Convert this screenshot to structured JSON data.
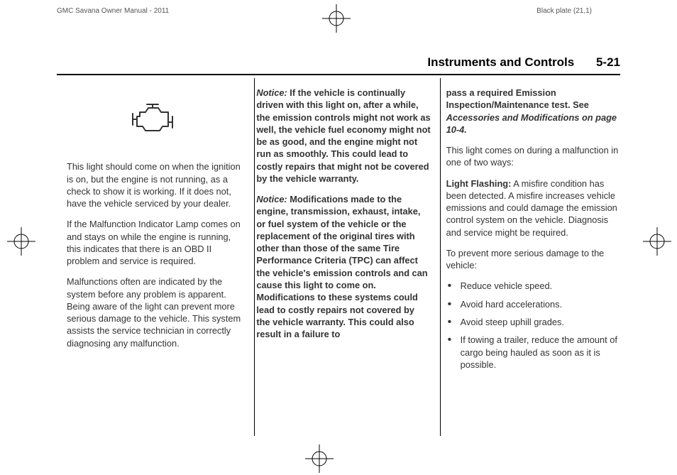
{
  "header_left": "GMC Savana Owner Manual - 2011",
  "header_right": "Black plate (21,1)",
  "page_title": "Instruments and Controls",
  "page_number": "5-21",
  "col1": {
    "p1": "This light should come on when the ignition is on, but the engine is not running, as a check to show it is working. If it does not, have the vehicle serviced by your dealer.",
    "p2": "If the Malfunction Indicator Lamp comes on and stays on while the engine is running, this indicates that there is an OBD II problem and service is required.",
    "p3": "Malfunctions often are indicated by the system before any problem is apparent. Being aware of the light can prevent more serious damage to the vehicle. This system assists the service technician in correctly diagnosing any malfunction."
  },
  "col2": {
    "notice1_label": "Notice:",
    "notice1_body": " If the vehicle is continually driven with this light on, after a while, the emission controls might not work as well, the vehicle fuel economy might not be as good, and the engine might not run as smoothly. This could lead to costly repairs that might not be covered by the vehicle warranty.",
    "notice2_label": "Notice:",
    "notice2_body": " Modifications made to the engine, transmission, exhaust, intake, or fuel system of the vehicle or the replacement of the original tires with other than those of the same Tire Performance Criteria (TPC) can affect the vehicle's emission controls and can cause this light to come on. Modifications to these systems could lead to costly repairs not covered by the vehicle warranty. This could also result in a failure to "
  },
  "col3": {
    "cont_bold": "pass a required Emission Inspection/Maintenance test. See ",
    "cont_ital": "Accessories and Modifications on page 10‑4.",
    "p1": "This light comes on during a malfunction in one of two ways:",
    "flash_label": "Light Flashing:",
    "flash_body": "  A misfire condition has been detected. A misfire increases vehicle emissions and could damage the emission control system on the vehicle. Diagnosis and service might be required.",
    "p2": "To prevent more serious damage to the vehicle:",
    "bullets": [
      "Reduce vehicle speed.",
      "Avoid hard accelerations.",
      "Avoid steep uphill grades.",
      "If towing a trailer, reduce the amount of cargo being hauled as soon as it is possible."
    ]
  }
}
